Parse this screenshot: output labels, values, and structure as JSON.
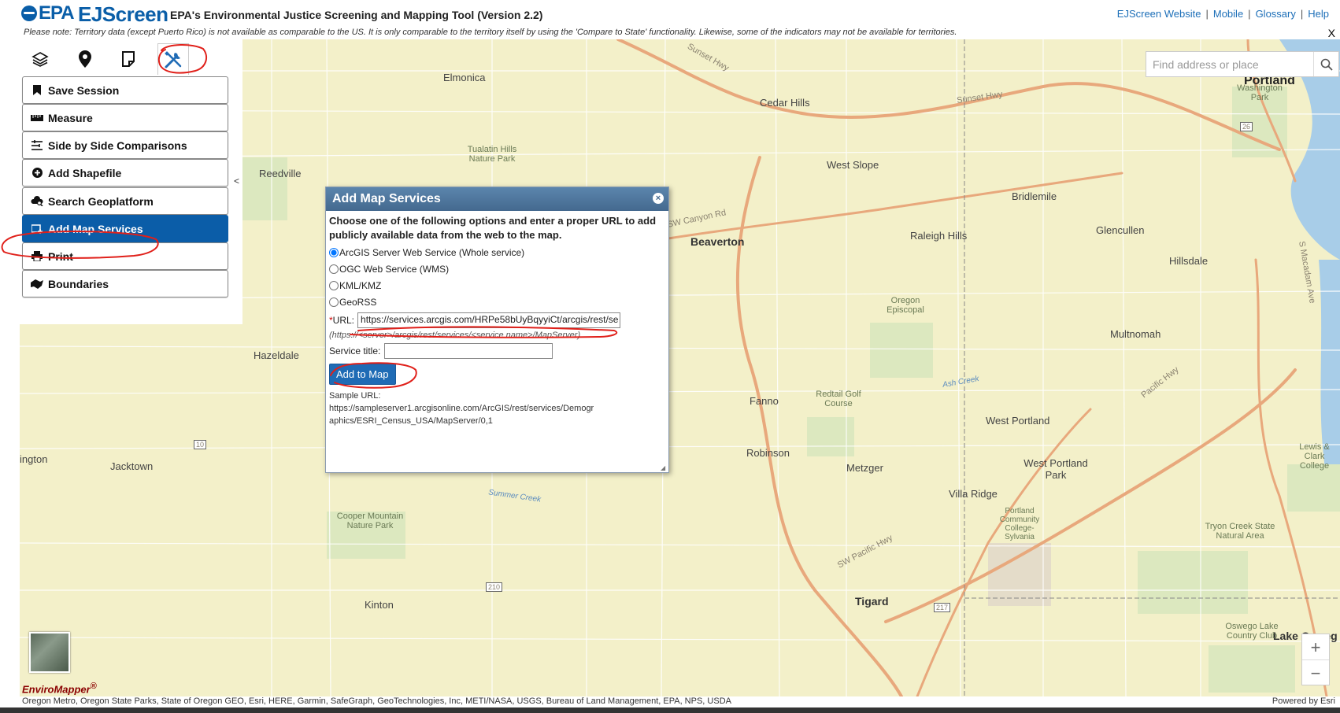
{
  "header": {
    "logo_text": "EPA",
    "app_name": "EJScreen",
    "subtitle": "EPA's Environmental Justice Screening and Mapping Tool (Version 2.2)",
    "links": [
      "EJScreen Website",
      "Mobile",
      "Glossary",
      "Help"
    ],
    "link_separator": "|"
  },
  "notice": {
    "text": "Please note: Territory data (except Puerto Rico) is not available as comparable to the US. It is only comparable to the territory itself by using the 'Compare to State' functionality. Likewise, some of the indicators may not be available for territories.",
    "close": "X"
  },
  "tabs": [
    {
      "icon": "layers-icon"
    },
    {
      "icon": "map-pin-icon"
    },
    {
      "icon": "note-icon"
    },
    {
      "icon": "tools-icon",
      "active": true
    }
  ],
  "menu": [
    {
      "label": "Save Session",
      "icon": "bookmark-icon"
    },
    {
      "label": "Measure",
      "icon": "ruler-icon"
    },
    {
      "label": "Side by Side Comparisons",
      "icon": "compare-icon"
    },
    {
      "label": "Add Shapefile",
      "icon": "plus-circle-icon"
    },
    {
      "label": "Search Geoplatform",
      "icon": "cloud-search-icon"
    },
    {
      "label": "Add Map Services",
      "icon": "add-map-icon",
      "active": true
    },
    {
      "label": "Print",
      "icon": "printer-icon"
    },
    {
      "label": "Boundaries",
      "icon": "boundaries-icon"
    }
  ],
  "collapse": "<",
  "dialog": {
    "title": "Add Map Services",
    "close": "×",
    "intro": "Choose one of the following options and enter a proper URL to add publicly available data from the web to the map.",
    "options": [
      {
        "label": "ArcGIS Server Web Service (Whole service)",
        "checked": true
      },
      {
        "label": "OGC Web Service (WMS)",
        "checked": false
      },
      {
        "label": "KML/KMZ",
        "checked": false
      },
      {
        "label": "GeoRSS",
        "checked": false
      }
    ],
    "url_required_mark": "*",
    "url_label": "URL:",
    "url_value": "https://services.arcgis.com/HRPe58bUyBqyyiCt/arcgis/rest/se",
    "url_hint": "(https://<server>/arcgis/rest/services/<service name>/MapServer)",
    "service_title_label": "Service title:",
    "service_title_value": "",
    "add_button": "Add to Map",
    "sample_label": "Sample URL:",
    "sample_url_line1": "https://sampleserver1.arcgisonline.com/ArcGIS/rest/services/Demogr",
    "sample_url_line2": "aphics/ESRI_Census_USA/MapServer/0,1"
  },
  "search": {
    "placeholder": "Find address or place"
  },
  "map_labels": {
    "portland": "Portland",
    "beaverton": "Beaverton",
    "tigard": "Tigard",
    "elmonica": "Elmonica",
    "cedar_hills": "Cedar Hills",
    "reedville": "Reedville",
    "west_slope": "West Slope",
    "bridlemile": "Bridlemile",
    "raleigh_hills": "Raleigh Hills",
    "glencullen": "Glencullen",
    "hillsdale": "Hillsdale",
    "multnomah": "Multnomah",
    "hazeldale": "Hazeldale",
    "fanno": "Fanno",
    "robinson": "Robinson",
    "west_portland": "West Portland",
    "west_portland_park": "West Portland Park",
    "metzger": "Metzger",
    "villa_ridge": "Villa Ridge",
    "jacktown": "Jacktown",
    "kinton": "Kinton",
    "ington": "ington",
    "lake_oswego": "Lake Osweg",
    "tualatin_hills": "Tualatin Hills Nature Park",
    "cooper_mountain": "Cooper Mountain Nature Park",
    "washington_park": "Washington Park",
    "oregon_episcopal": "Oregon Episcopal",
    "redtail": "Redtail Golf Course",
    "pcc": "Portland Community College-Sylvania",
    "tryon": "Tryon Creek State Natural Area",
    "lewis_clark": "Lewis & Clark College",
    "oswego_lake": "Oswego Lake Country Club",
    "sunset_hwy": "Sunset Hwy",
    "sunset_hwy2": "Sunset Hwy",
    "pacific_hwy": "Pacific Hwy",
    "sw_pacific_hwy": "SW Pacific Hwy",
    "canyon_rd": "SW Canyon Rd",
    "sw_macadam": "S Macadam Ave",
    "summer_creek": "Summer Creek",
    "ash_creek": "Ash Creek",
    "hwy_26": "26",
    "hwy_10": "10",
    "hwy_210": "210",
    "hwy_217": "217"
  },
  "enviromapper": "EnviroMapper",
  "attribution": "Oregon Metro, Oregon State Parks, State of Oregon GEO, Esri, HERE, Garmin, SafeGraph, GeoTechnologies, Inc, METI/NASA, USGS, Bureau of Land Management, EPA, NPS, USDA",
  "powered_by": "Powered by Esri",
  "zoom": {
    "in": "+",
    "out": "−"
  }
}
